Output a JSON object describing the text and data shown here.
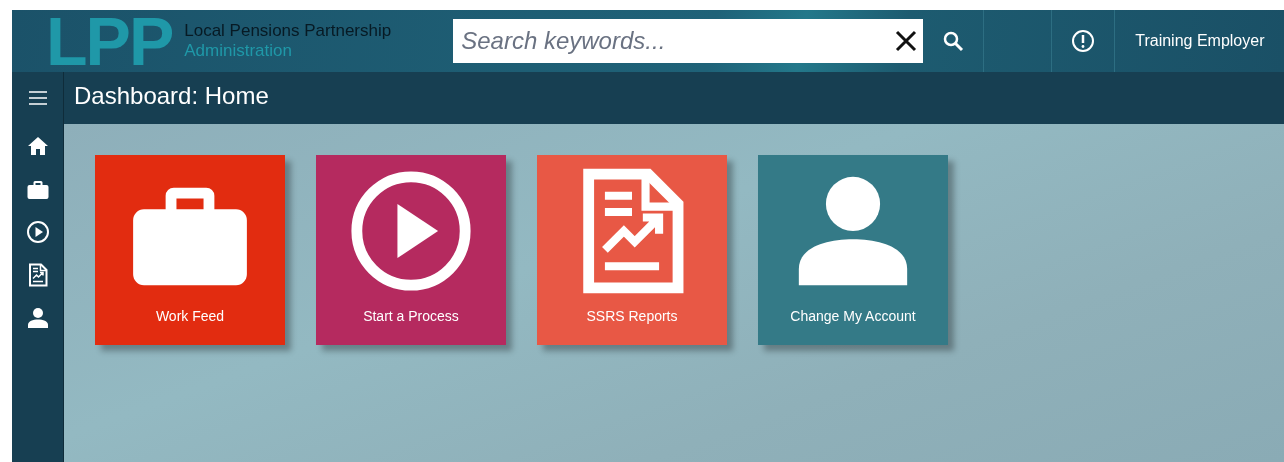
{
  "header": {
    "logo": "LPP",
    "org_name": "Local Pensions Partnership",
    "org_sub": "Administration",
    "search": {
      "placeholder": "Search keywords..."
    },
    "user": "Training Employer"
  },
  "page_title": "Dashboard: Home",
  "sidebar": {
    "items": [
      {
        "kind": "home"
      },
      {
        "kind": "briefcase"
      },
      {
        "kind": "play"
      },
      {
        "kind": "report"
      },
      {
        "kind": "user"
      }
    ]
  },
  "tiles": [
    {
      "label": "Work Feed",
      "kind": "briefcase",
      "color": "#e22c10"
    },
    {
      "label": "Start a Process",
      "kind": "play",
      "color": "#b52a5f"
    },
    {
      "label": "SSRS Reports",
      "kind": "report",
      "color": "#e85845"
    },
    {
      "label": "Change My Account",
      "kind": "user",
      "color": "#347a87"
    }
  ]
}
